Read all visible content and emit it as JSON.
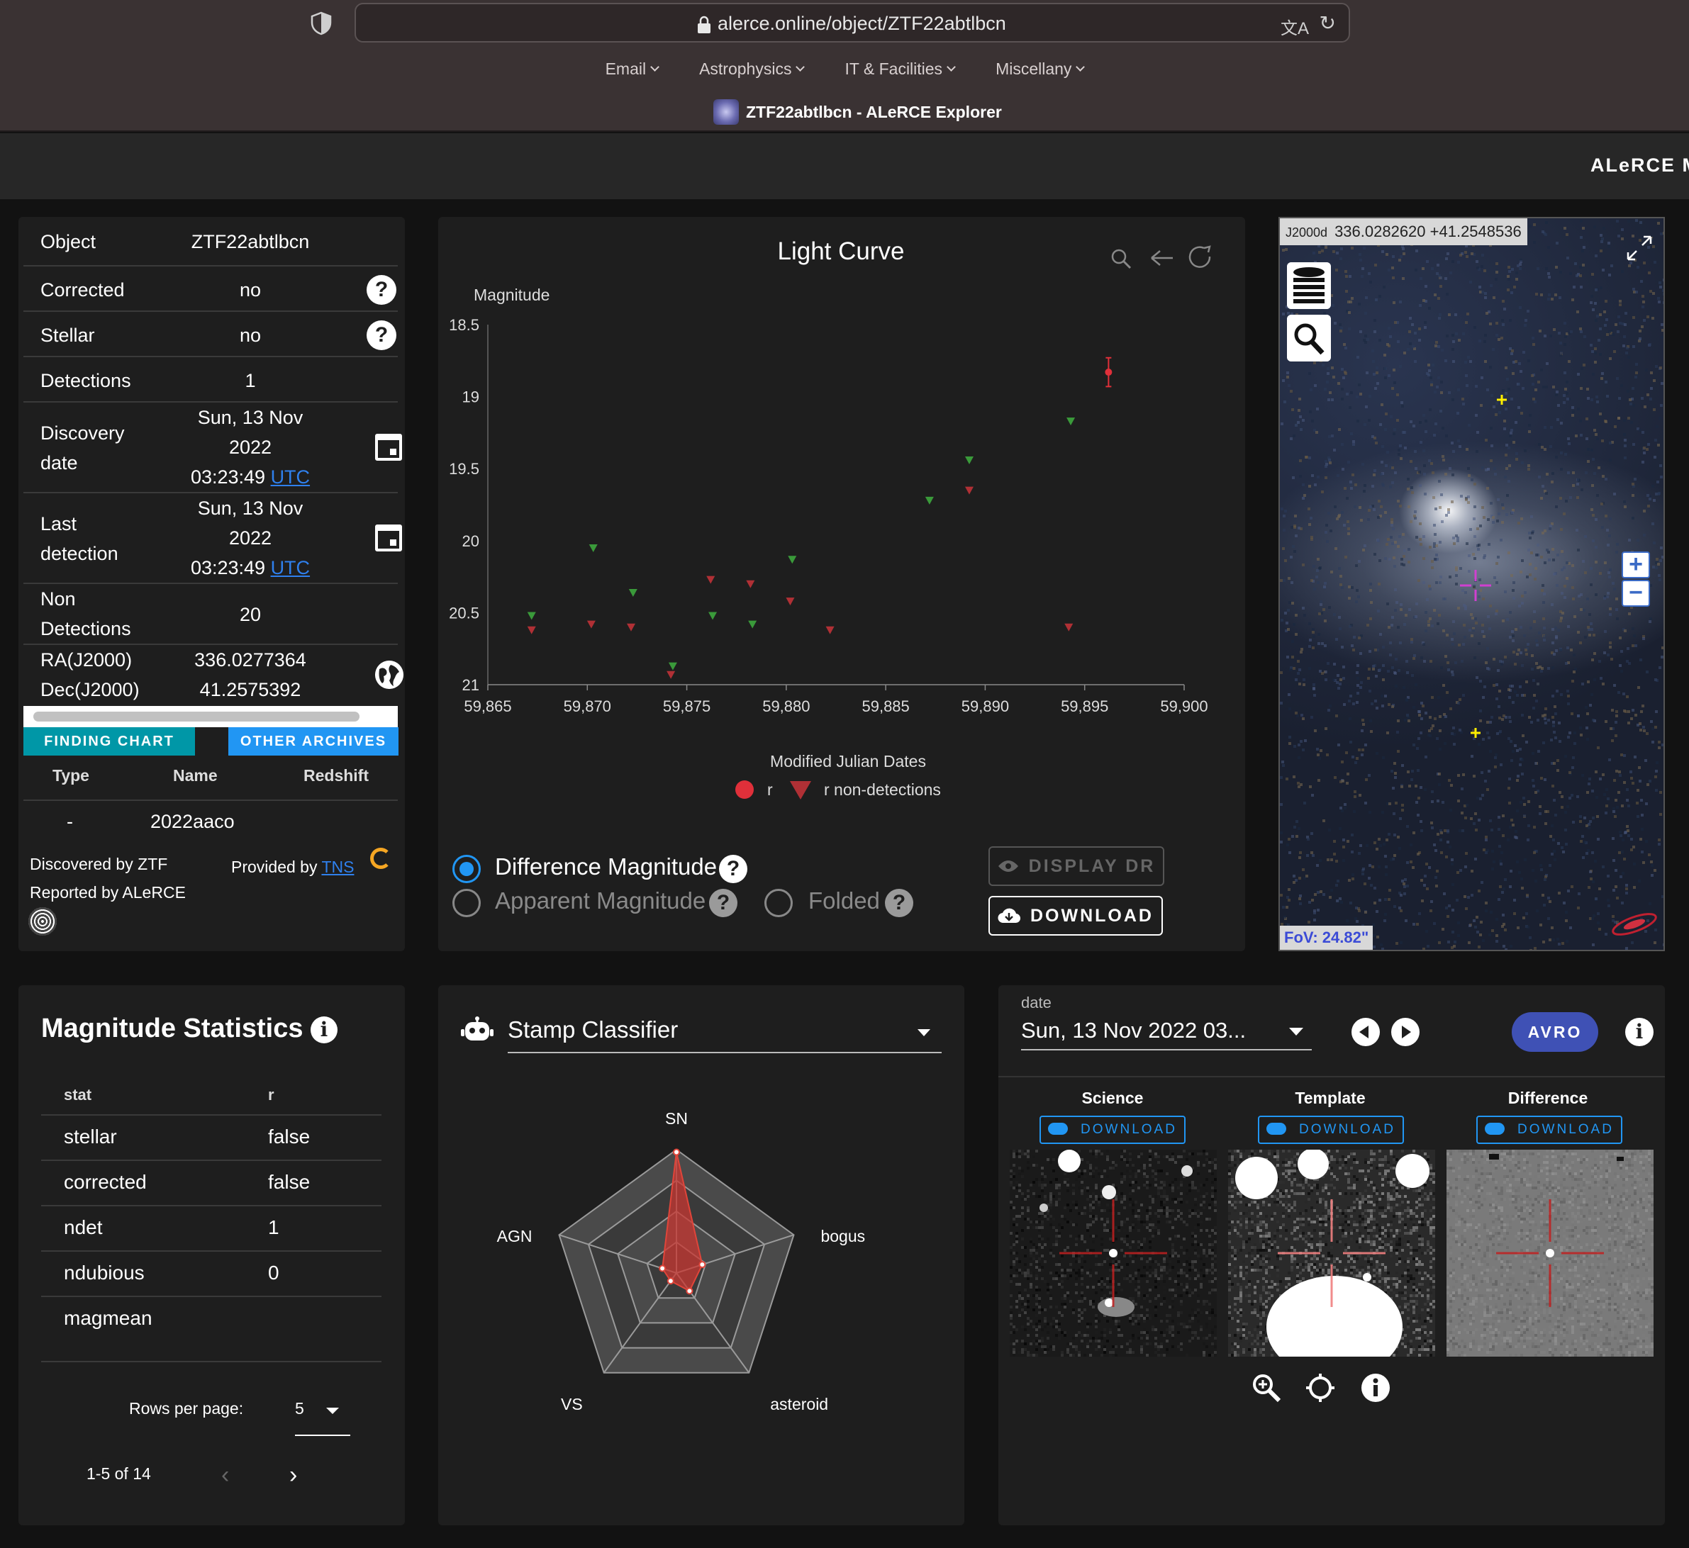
{
  "browser": {
    "url": "alerce.online/object/ZTF22abtlbcn",
    "bookmarks": [
      "Email",
      "Astrophysics",
      "IT & Facilities",
      "Miscellany"
    ],
    "tab_title": "ZTF22abtlbcn - ALeRCE Explorer"
  },
  "appbar": {
    "title": "ALeRCE M"
  },
  "object": {
    "rows": {
      "object": {
        "label": "Object",
        "value": "ZTF22abtlbcn"
      },
      "corrected": {
        "label": "Corrected",
        "value": "no"
      },
      "stellar": {
        "label": "Stellar",
        "value": "no"
      },
      "detections": {
        "label": "Detections",
        "value": "1"
      },
      "discovery": {
        "label1": "Discovery",
        "label2": "date",
        "line1": "Sun, 13 Nov",
        "line2": "2022",
        "line3": "03:23:49",
        "utc": "UTC"
      },
      "last": {
        "label1": "Last",
        "label2": "detection",
        "line1": "Sun, 13 Nov",
        "line2": "2022",
        "line3": "03:23:49",
        "utc": "UTC"
      },
      "non_det": {
        "label1": "Non",
        "label2": "Detections",
        "value": "20"
      },
      "ra": {
        "label": "RA(J2000)",
        "value": "336.0277364"
      },
      "dec": {
        "label": "Dec(J2000)",
        "value": "41.2575392"
      }
    },
    "buttons": {
      "finding_chart": "FINDING CHART",
      "other_archives": "OTHER ARCHIVES"
    },
    "xmatch": {
      "headers": [
        "Type",
        "Name",
        "Redshift"
      ],
      "row": {
        "type": "-",
        "name": "2022aaco",
        "redshift": ""
      }
    },
    "discovered_by": "Discovered by ZTF",
    "reported_by": "Reported by ALeRCE",
    "provided_by": "Provided by",
    "tns": "TNS"
  },
  "light_curve": {
    "title": "Light Curve",
    "options": {
      "difference": "Difference Magnitude",
      "apparent": "Apparent Magnitude",
      "folded": "Folded"
    },
    "buttons": {
      "display_dr": "DISPLAY DR",
      "download": "DOWNLOAD"
    }
  },
  "chart_data": {
    "type": "scatter",
    "title": "Light Curve",
    "xlabel": "Modified Julian Dates",
    "ylabel": "Magnitude",
    "xlim": [
      59865,
      59900
    ],
    "ylim": [
      21,
      18.5
    ],
    "y_inverted": true,
    "x_ticks": [
      "59,865",
      "59,870",
      "59,875",
      "59,880",
      "59,885",
      "59,890",
      "59,895",
      "59,900"
    ],
    "y_ticks": [
      "18.5",
      "19",
      "19.5",
      "20",
      "20.5",
      "21"
    ],
    "series": [
      {
        "name": "r",
        "marker": "circle",
        "color": "#e0303a",
        "points": [
          {
            "x": 59896.2,
            "y": 18.83,
            "err": 0.1
          }
        ]
      },
      {
        "name": "r non-detections",
        "marker": "triangle-down",
        "color": "#b03035",
        "points": [
          {
            "x": 59867.2,
            "y": 20.62
          },
          {
            "x": 59870.2,
            "y": 20.58
          },
          {
            "x": 59872.2,
            "y": 20.6
          },
          {
            "x": 59874.2,
            "y": 20.93
          },
          {
            "x": 59876.2,
            "y": 20.27
          },
          {
            "x": 59878.2,
            "y": 20.3
          },
          {
            "x": 59880.2,
            "y": 20.42
          },
          {
            "x": 59882.2,
            "y": 20.62
          },
          {
            "x": 59889.2,
            "y": 19.65
          },
          {
            "x": 59894.2,
            "y": 20.6
          }
        ]
      },
      {
        "name": "g non-detections",
        "marker": "triangle-down",
        "color": "#3a9a3a",
        "points": [
          {
            "x": 59867.2,
            "y": 20.52
          },
          {
            "x": 59870.3,
            "y": 20.05
          },
          {
            "x": 59872.3,
            "y": 20.36
          },
          {
            "x": 59874.3,
            "y": 20.87
          },
          {
            "x": 59876.3,
            "y": 20.52
          },
          {
            "x": 59878.3,
            "y": 20.58
          },
          {
            "x": 59880.3,
            "y": 20.13
          },
          {
            "x": 59887.2,
            "y": 19.72
          },
          {
            "x": 59889.2,
            "y": 19.44
          },
          {
            "x": 59894.3,
            "y": 19.17
          }
        ]
      }
    ],
    "legend": [
      "r",
      "r non-detections"
    ]
  },
  "aladin": {
    "frame": "J2000d",
    "coords": "336.0282620 +41.2548536",
    "fov": "FoV: 24.82\"",
    "zoom_in": "+",
    "zoom_out": "−"
  },
  "mag_stats": {
    "title": "Magnitude Statistics",
    "headers": [
      "stat",
      "r"
    ],
    "rows": [
      {
        "stat": "stellar",
        "r": "false"
      },
      {
        "stat": "corrected",
        "r": "false"
      },
      {
        "stat": "ndet",
        "r": "1"
      },
      {
        "stat": "ndubious",
        "r": "0"
      },
      {
        "stat": "magmean",
        "r": ""
      }
    ],
    "rows_per_page_label": "Rows per page:",
    "rows_per_page": "5",
    "range": "1-5 of 14"
  },
  "stamp_classifier": {
    "selected": "Stamp Classifier",
    "classes": [
      "SN",
      "bogus",
      "asteroid",
      "VS",
      "AGN"
    ],
    "probabilities": [
      0.98,
      0.22,
      0.18,
      0.08,
      0.12
    ]
  },
  "stamps": {
    "date_label": "date",
    "date_value": "Sun, 13 Nov 2022 03...",
    "avro": "AVRO",
    "titles": [
      "Science",
      "Template",
      "Difference"
    ],
    "download": "DOWNLOAD"
  }
}
